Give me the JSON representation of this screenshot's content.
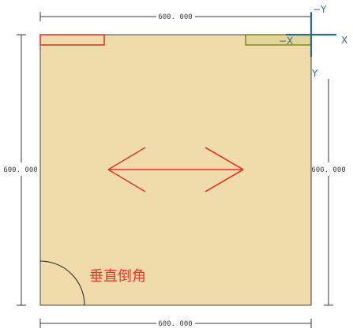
{
  "dimensions": {
    "top": "600. 000",
    "bottom": "600. 000",
    "left": "600. 000",
    "right": "600. 000"
  },
  "axes": {
    "pos_x": "X",
    "neg_x": "−X",
    "pos_y": "Y",
    "neg_y": "−Y"
  },
  "annotation": {
    "bevel_label": "垂直倒角"
  },
  "colors": {
    "panel_fill": "#efdcaa",
    "panel_stroke": "#444444",
    "arrow": "#e03a2a",
    "axis": "#2f6f86",
    "left_tab_stroke": "#d23b2b",
    "right_tab_stroke": "#8a8a2a",
    "dimension": "#3a3a3a"
  },
  "icons": {
    "grain_direction": "double-arrow-icon",
    "coordinate_cross": "axis-cross-icon"
  }
}
